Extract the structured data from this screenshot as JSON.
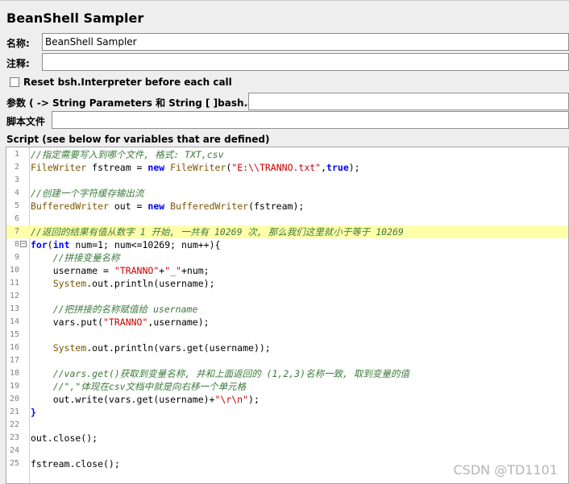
{
  "title": "BeanShell Sampler",
  "name_label": "名称:",
  "name_value": "BeanShell Sampler",
  "comment_label": "注释:",
  "comment_value": "",
  "reset_label": "Reset bsh.Interpreter before each call",
  "params_label": "参数 ( -> String Parameters 和 String [ ]bash.args)",
  "params_value": "",
  "script_file_label": "脚本文件",
  "script_file_value": "",
  "script_label": "Script (see below for variables that are defined)",
  "code_lines": [
    {
      "n": "1",
      "parts": [
        [
          "c",
          "//指定需要写入到哪个文件, 格式: TXT,csv"
        ]
      ]
    },
    {
      "n": "2",
      "parts": [
        [
          "t",
          "FileWriter"
        ],
        [
          "p",
          " fstream = "
        ],
        [
          "k",
          "new"
        ],
        [
          "p",
          " "
        ],
        [
          "t",
          "FileWriter"
        ],
        [
          "p",
          "("
        ],
        [
          "s",
          "\"E:\\\\TRANNO.txt\""
        ],
        [
          "p",
          ","
        ],
        [
          "k",
          "true"
        ],
        [
          "p",
          ");"
        ]
      ]
    },
    {
      "n": "3",
      "parts": []
    },
    {
      "n": "4",
      "parts": [
        [
          "c",
          "//创建一个字符缓存输出流"
        ]
      ]
    },
    {
      "n": "5",
      "parts": [
        [
          "t",
          "BufferedWriter"
        ],
        [
          "p",
          " out = "
        ],
        [
          "k",
          "new"
        ],
        [
          "p",
          " "
        ],
        [
          "t",
          "BufferedWriter"
        ],
        [
          "p",
          "(fstream);"
        ]
      ]
    },
    {
      "n": "6",
      "parts": []
    },
    {
      "n": "7",
      "parts": [
        [
          "c",
          "//返回的结果有值从数字 1 开始, 一共有 10269 次, 那么我们这里就小于等于 10269"
        ]
      ],
      "hl": true
    },
    {
      "n": "8",
      "parts": [
        [
          "k",
          "for"
        ],
        [
          "p",
          "("
        ],
        [
          "k",
          "int"
        ],
        [
          "p",
          " num=1; num<=10269; num++){"
        ]
      ],
      "fold": true
    },
    {
      "n": "9",
      "parts": [
        [
          "p",
          "    "
        ],
        [
          "c",
          "//拼接变量名称"
        ]
      ]
    },
    {
      "n": "10",
      "parts": [
        [
          "p",
          "    username = "
        ],
        [
          "s",
          "\"TRANNO\""
        ],
        [
          "p",
          "+"
        ],
        [
          "s",
          "\"_\""
        ],
        [
          "p",
          "+num;"
        ]
      ]
    },
    {
      "n": "11",
      "parts": [
        [
          "p",
          "    "
        ],
        [
          "t",
          "System"
        ],
        [
          "p",
          ".out.println(username);"
        ]
      ]
    },
    {
      "n": "12",
      "parts": []
    },
    {
      "n": "13",
      "parts": [
        [
          "p",
          "    "
        ],
        [
          "c",
          "//把拼接的名称赋值给 username"
        ]
      ]
    },
    {
      "n": "14",
      "parts": [
        [
          "p",
          "    vars.put("
        ],
        [
          "s",
          "\"TRANNO\""
        ],
        [
          "p",
          ",username);"
        ]
      ]
    },
    {
      "n": "15",
      "parts": []
    },
    {
      "n": "16",
      "parts": [
        [
          "p",
          "    "
        ],
        [
          "t",
          "System"
        ],
        [
          "p",
          ".out.println(vars.get(username));"
        ]
      ]
    },
    {
      "n": "17",
      "parts": []
    },
    {
      "n": "18",
      "parts": [
        [
          "p",
          "    "
        ],
        [
          "c",
          "//vars.get()获取到变量名称, 并和上面返回的 (1,2,3)名称一致, 取到变量的值"
        ]
      ]
    },
    {
      "n": "19",
      "parts": [
        [
          "p",
          "    "
        ],
        [
          "c",
          "//\",\"体现在csv文档中就是向右移一个单元格"
        ]
      ]
    },
    {
      "n": "20",
      "parts": [
        [
          "p",
          "    out.write(vars.get(username)+"
        ],
        [
          "s",
          "\"\\r\\n\""
        ],
        [
          "p",
          ");"
        ]
      ]
    },
    {
      "n": "21",
      "parts": [
        [
          "k",
          "}"
        ]
      ]
    },
    {
      "n": "22",
      "parts": []
    },
    {
      "n": "23",
      "parts": [
        [
          "p",
          "out.close();"
        ]
      ]
    },
    {
      "n": "24",
      "parts": []
    },
    {
      "n": "25",
      "parts": [
        [
          "p",
          "fstream.close();"
        ]
      ]
    }
  ],
  "watermark": "CSDN @TD1101"
}
